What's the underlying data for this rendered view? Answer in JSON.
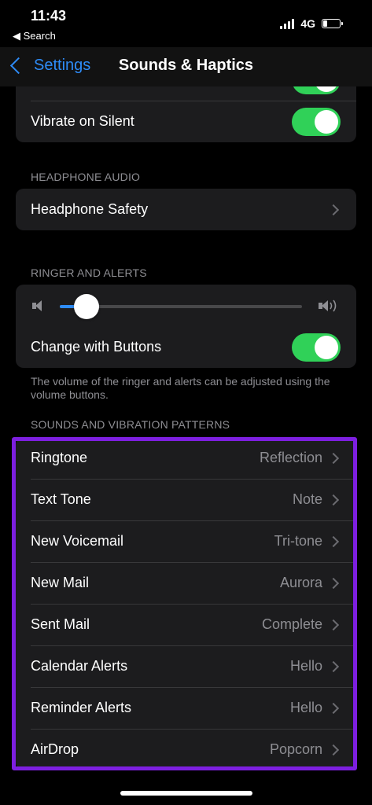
{
  "status_bar": {
    "time": "11:43",
    "back_app": "◀ Search",
    "network": "4G"
  },
  "nav": {
    "back_label": "Settings",
    "title": "Sounds & Haptics"
  },
  "top_group": {
    "vibrate_on_silent": {
      "label": "Vibrate on Silent",
      "on": true
    }
  },
  "headphone_audio": {
    "header": "HEADPHONE AUDIO",
    "items": [
      {
        "label": "Headphone Safety"
      }
    ]
  },
  "ringer_alerts": {
    "header": "RINGER AND ALERTS",
    "volume_level": 0.11,
    "change_with_buttons": {
      "label": "Change with Buttons",
      "on": true
    },
    "footer": "The volume of the ringer and alerts can be adjusted using the volume buttons."
  },
  "sounds_patterns": {
    "header": "SOUNDS AND VIBRATION PATTERNS",
    "items": [
      {
        "label": "Ringtone",
        "value": "Reflection"
      },
      {
        "label": "Text Tone",
        "value": "Note"
      },
      {
        "label": "New Voicemail",
        "value": "Tri-tone"
      },
      {
        "label": "New Mail",
        "value": "Aurora"
      },
      {
        "label": "Sent Mail",
        "value": "Complete"
      },
      {
        "label": "Calendar Alerts",
        "value": "Hello"
      },
      {
        "label": "Reminder Alerts",
        "value": "Hello"
      },
      {
        "label": "AirDrop",
        "value": "Popcorn"
      }
    ]
  },
  "colors": {
    "accent": "#2e8cf7",
    "toggle_on": "#30d158",
    "highlight": "#7d1fe0"
  }
}
